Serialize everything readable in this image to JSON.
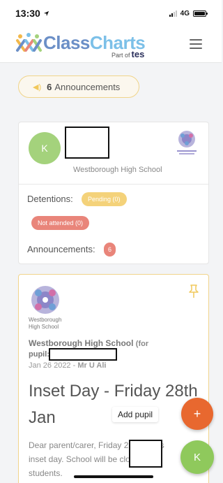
{
  "status_bar": {
    "time": "13:30",
    "network": "4G"
  },
  "header": {
    "logo_class": "Class",
    "logo_charts": "Charts",
    "part_of": "Part of",
    "part_of_brand": "tes"
  },
  "announcements_pill": {
    "count": "6",
    "label": "Announcements"
  },
  "pupil_card": {
    "avatar_initial": "K",
    "school_name": "Westborough High School",
    "school_badge_text": "Westborough High School",
    "detentions_label": "Detentions:",
    "pending_badge": "Pending (0)",
    "not_attended_badge": "Not attended (0)",
    "announcements_label": "Announcements:",
    "announcements_count": "6"
  },
  "announcement_post": {
    "badge_caption": "Westborough High School",
    "school_name": "Westborough High School",
    "for_text": "(for",
    "pupil_label": "pupil:",
    "date": "Jan 26 2022 -",
    "author": "Mr U Ali",
    "title": "Inset Day - Friday 28th Jan",
    "body_line1": "Dear parent/carer, Friday 28th Jan is",
    "body_line2": "inset day. School will be closed to",
    "body_line3": "students."
  },
  "actions": {
    "add_pupil_label": "Add pupil",
    "fab_add_symbol": "+",
    "fab_user_initial": "K"
  },
  "colors": {
    "brand_blue": "#6b8fc7",
    "brand_light_blue": "#7cc0e8",
    "pending": "#f4d27a",
    "not_attended": "#e9857a",
    "fab_orange": "#e8682f",
    "avatar_green": "#a4d27c",
    "fab_green": "#8fc95c"
  },
  "icons": [
    "location-arrow-icon",
    "signal-icon",
    "battery-icon",
    "menu-icon",
    "speaker-icon",
    "pin-icon",
    "school-crest-icon"
  ]
}
